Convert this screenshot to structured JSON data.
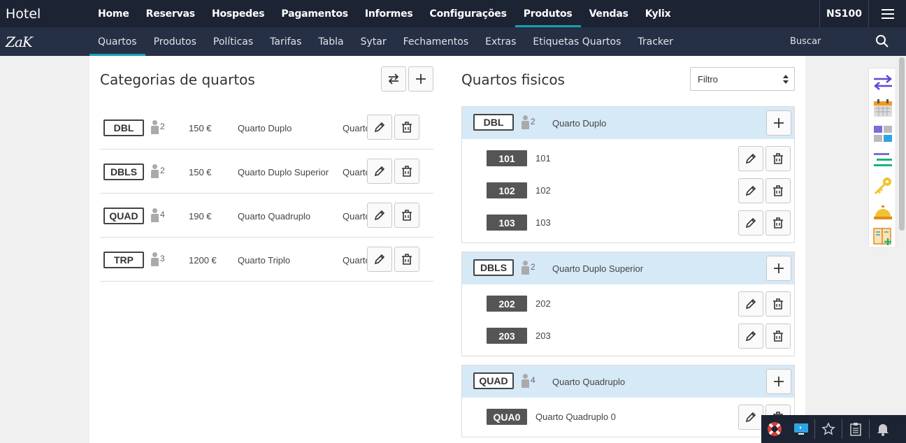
{
  "topbar": {
    "brand": "Hotel",
    "items": [
      "Home",
      "Reservas",
      "Hospedes",
      "Pagamentos",
      "Informes",
      "Configurações",
      "Produtos",
      "Vendas",
      "Kylix"
    ],
    "active": "Produtos",
    "account": "NS100"
  },
  "subbar": {
    "logo": "ZaK",
    "items": [
      "Quartos",
      "Produtos",
      "Políticas",
      "Tarifas",
      "Tabla",
      "Sytar",
      "Fechamentos",
      "Extras",
      "Etiquetas Quartos",
      "Tracker"
    ],
    "active": "Quartos",
    "search_label": "Buscar"
  },
  "categories": {
    "title": "Categorias de quartos",
    "rows": [
      {
        "code": "DBL",
        "occupancy": "2",
        "price": "150 €",
        "name": "Quarto Duplo",
        "type": "Quarto"
      },
      {
        "code": "DBLS",
        "occupancy": "2",
        "price": "150 €",
        "name": "Quarto Duplo Superior",
        "type": "Quarto"
      },
      {
        "code": "QUAD",
        "occupancy": "4",
        "price": "190 €",
        "name": "Quarto Quadruplo",
        "type": "Quarto"
      },
      {
        "code": "TRP",
        "occupancy": "3",
        "price": "1200 €",
        "name": "Quarto Triplo",
        "type": "Quarto"
      }
    ]
  },
  "rooms": {
    "title": "Quartos fisicos",
    "filter": {
      "value": "Filtro"
    },
    "groups": [
      {
        "code": "DBL",
        "occupancy": "2",
        "name": "Quarto Duplo",
        "rooms": [
          {
            "tag": "101",
            "label": "101"
          },
          {
            "tag": "102",
            "label": "102"
          },
          {
            "tag": "103",
            "label": "103"
          }
        ]
      },
      {
        "code": "DBLS",
        "occupancy": "2",
        "name": "Quarto Duplo Superior",
        "rooms": [
          {
            "tag": "202",
            "label": "202"
          },
          {
            "tag": "203",
            "label": "203"
          }
        ]
      },
      {
        "code": "QUAD",
        "occupancy": "4",
        "name": "Quarto Quadruplo",
        "rooms": [
          {
            "tag": "QUA0",
            "label": "Quarto Quadruplo 0"
          }
        ]
      }
    ]
  },
  "colors": {
    "accent": "#19a0b4",
    "topbar": "#1c2333",
    "subbar": "#263044",
    "group_header": "#d6e9f7"
  }
}
